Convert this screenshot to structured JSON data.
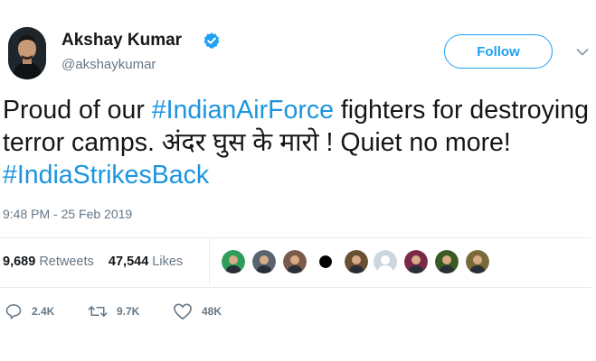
{
  "author": {
    "name": "Akshay Kumar",
    "handle": "@akshaykumar",
    "verified": true
  },
  "follow_button": {
    "label": "Follow"
  },
  "tweet": {
    "segments": [
      {
        "text": "Proud of our ",
        "hashtag": false
      },
      {
        "text": "#IndianAirForce",
        "hashtag": true
      },
      {
        "text": " fighters for destroying terror camps. अंदर घुस के मारो ! Quiet no more! ",
        "hashtag": false
      },
      {
        "text": "#IndiaStrikesBack",
        "hashtag": true
      }
    ],
    "timestamp": "9:48 PM - 25 Feb 2019"
  },
  "stats": {
    "retweets_count": "9,689",
    "retweets_label": "Retweets",
    "likes_count": "47,544",
    "likes_label": "Likes"
  },
  "liked_by": [
    {
      "icon": "user-avatar-icon",
      "color": "#2e9c5a"
    },
    {
      "icon": "user-avatar-icon",
      "color": "#5a6470"
    },
    {
      "icon": "user-avatar-icon",
      "color": "#7a5a48"
    },
    {
      "icon": "user-avatar-icon",
      "color": "#000000"
    },
    {
      "icon": "user-avatar-icon",
      "color": "#6a5032"
    },
    {
      "icon": "user-avatar-icon",
      "color": "#ccd6dd"
    },
    {
      "icon": "user-avatar-icon",
      "color": "#7a2a48"
    },
    {
      "icon": "user-avatar-icon",
      "color": "#3a5a24"
    },
    {
      "icon": "user-avatar-icon",
      "color": "#7a6a3a"
    }
  ],
  "actions": {
    "reply_count": "2.4K",
    "retweet_count": "9.7K",
    "like_count": "48K"
  },
  "colors": {
    "accent": "#1da1f2",
    "hashtag": "#1b95e0",
    "secondary_text": "#657786",
    "divider": "#e6ecf0"
  }
}
